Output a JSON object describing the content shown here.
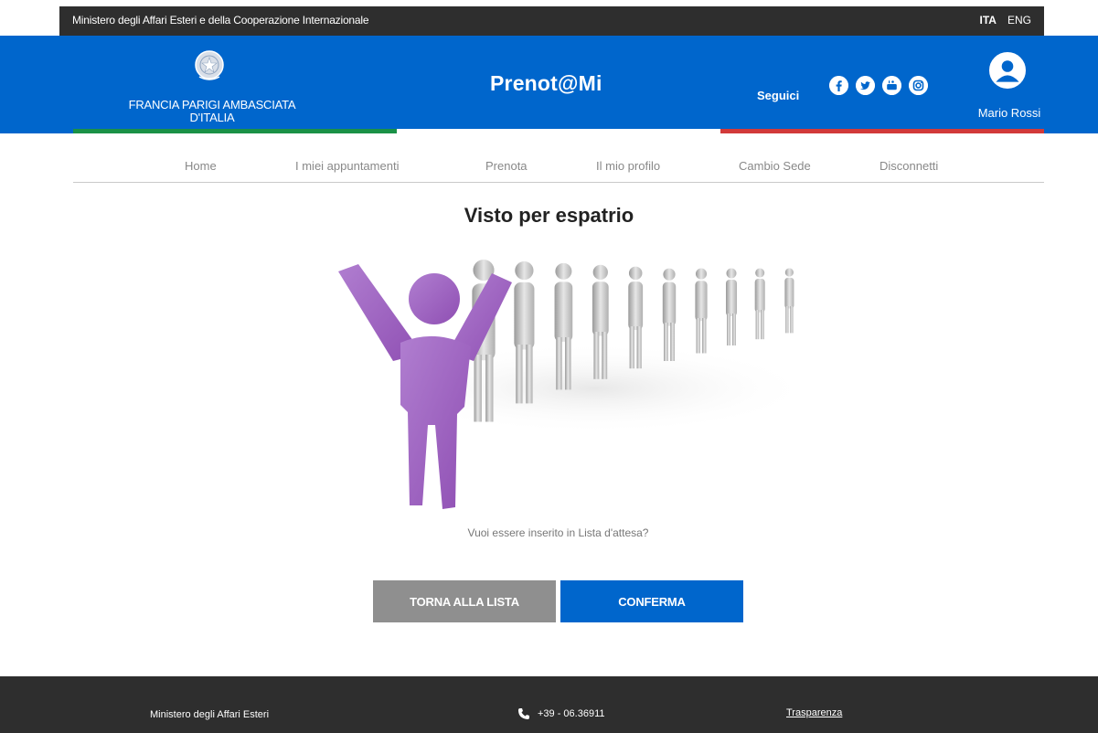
{
  "topbar": {
    "ministry": "Ministero degli Affari Esteri e della Cooperazione Internazionale",
    "lang_ita": "ITA",
    "lang_eng": "ENG"
  },
  "header": {
    "embassy": "FRANCIA PARIGI AMBASCIATA D'ITALIA",
    "brand": "Prenot@Mi",
    "follow_label": "Seguici",
    "user_name": "Mario Rossi"
  },
  "socials": [
    "facebook-icon",
    "twitter-icon",
    "youtube-icon",
    "instagram-icon"
  ],
  "nav": {
    "items": [
      {
        "label": "Home"
      },
      {
        "label": "I miei appuntamenti"
      },
      {
        "label": "Prenota"
      },
      {
        "label": "Il mio profilo"
      },
      {
        "label": "Cambio Sede"
      },
      {
        "label": "Disconnetti"
      }
    ]
  },
  "main": {
    "title": "Visto per espatrio",
    "question": "Vuoi essere inserito in Lista d'attesa?",
    "back_button": "TORNA ALLA LISTA",
    "confirm_button": "CONFERMA"
  },
  "footer": {
    "ministry_line1": "Ministero degli Affari Esteri",
    "phone": "+39 - 06.36911",
    "transparency": "Trasparenza"
  },
  "colors": {
    "primary_blue": "#0066cc",
    "dark_bar": "#2e2e2e",
    "back_button_gray": "#8f8f8f",
    "illustration_figure": "#a46bc4",
    "flag_green": "#1a9146",
    "flag_red": "#d23a3a"
  }
}
